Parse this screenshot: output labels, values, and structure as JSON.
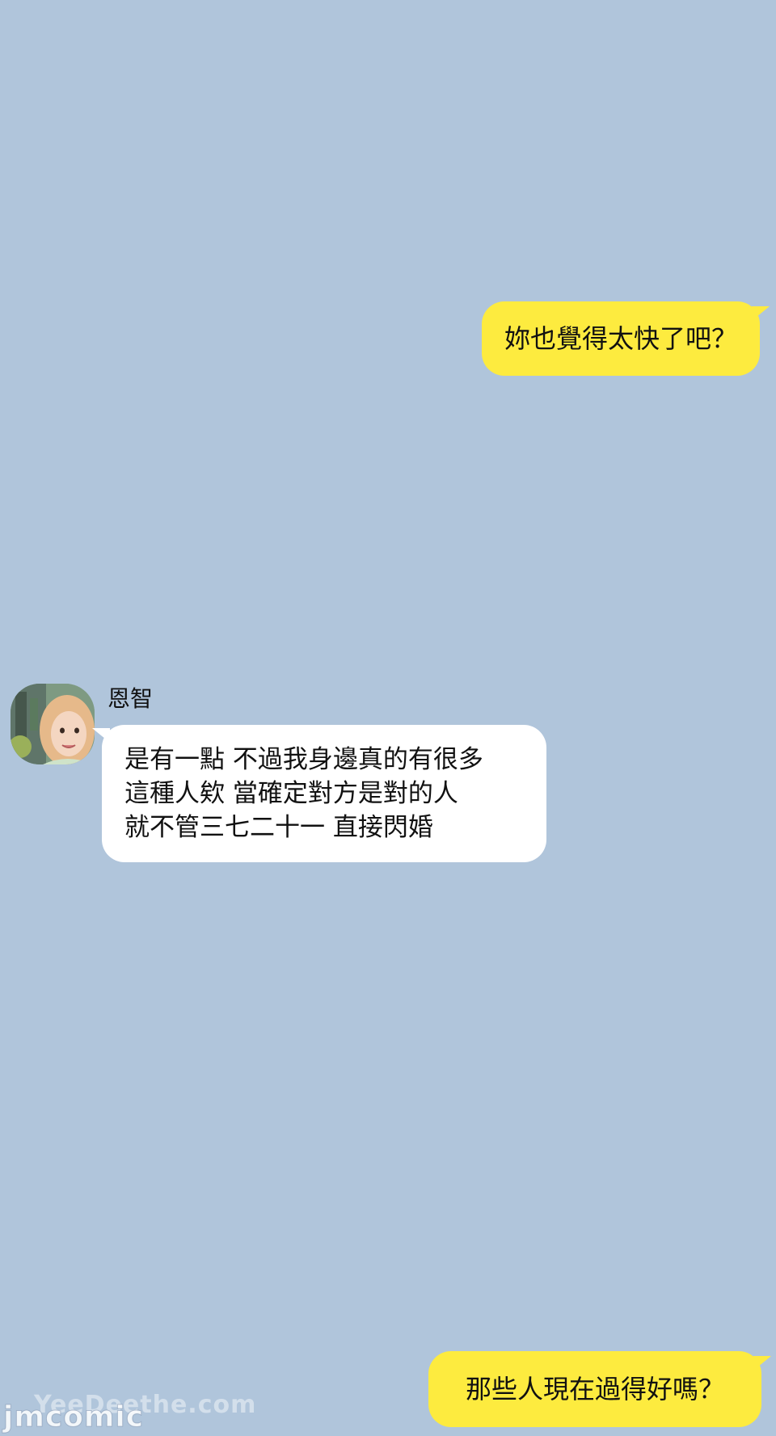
{
  "chat": {
    "messages": [
      {
        "direction": "outgoing",
        "text": "妳也覺得太快了吧？"
      },
      {
        "direction": "incoming",
        "sender": "恩智",
        "lines": [
          "是有一點 不過我身邊真的有很多",
          "這種人欸 當確定對方是對的人",
          "就不管三七二十一 直接閃婚"
        ]
      },
      {
        "direction": "outgoing",
        "text": "那些人現在過得好嗎？"
      }
    ]
  },
  "watermark": {
    "back": "YeeDeethe.com",
    "front": "jmcomic"
  },
  "colors": {
    "background": "#b0c5db",
    "outgoing_bubble": "#fdeb3f",
    "incoming_bubble": "#ffffff"
  }
}
